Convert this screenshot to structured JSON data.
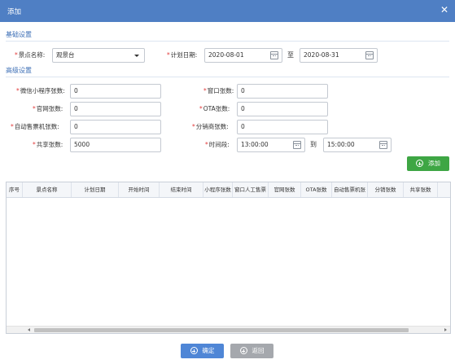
{
  "window": {
    "title": "添加",
    "close_glyph": "✕"
  },
  "basic": {
    "section_title": "基础设置",
    "scenic_label": "景点名称:",
    "scenic_value": "观景台",
    "plan_date_label": "计划日期:",
    "date_start": "2020-08-01",
    "date_to": "至",
    "date_end": "2020-08-31"
  },
  "advanced": {
    "section_title": "高级设置",
    "mini_program_label": "微信小程序张数:",
    "mini_program_value": "0",
    "window_label": "窗口张数:",
    "window_value": "0",
    "official_site_label": "官网张数:",
    "official_site_value": "0",
    "ota_label": "OTA张数:",
    "ota_value": "0",
    "vending_label": "自动售票机张数:",
    "vending_value": "0",
    "distributor_label": "分销商张数:",
    "distributor_value": "0",
    "shared_label": "共享张数:",
    "shared_value": "5000",
    "time_label": "时间段:",
    "time_start": "13:00:00",
    "time_to": "到",
    "time_end": "15:00:00",
    "add_button": "添加"
  },
  "table": {
    "columns": [
      "序号",
      "景点名称",
      "计划日期",
      "开始时间",
      "结束时间",
      "小程序张数",
      "窗口人工售票",
      "官网张数",
      "OTA张数",
      "自动售票机张",
      "分销张数",
      "共享张数"
    ]
  },
  "footer": {
    "confirm": "确定",
    "back": "返回"
  },
  "colors": {
    "title_bar": "#4f7fc4",
    "required_star": "#e23b3b",
    "add_button": "#3ea644",
    "confirm_button": "#4f86d6",
    "back_button": "#a5a8ad",
    "section_title": "#3d6fb6"
  },
  "icons": {
    "close": "close-icon",
    "calendar": "calendar-icon",
    "dropdown": "chevron-down-icon",
    "plus": "plus-circle-icon"
  }
}
